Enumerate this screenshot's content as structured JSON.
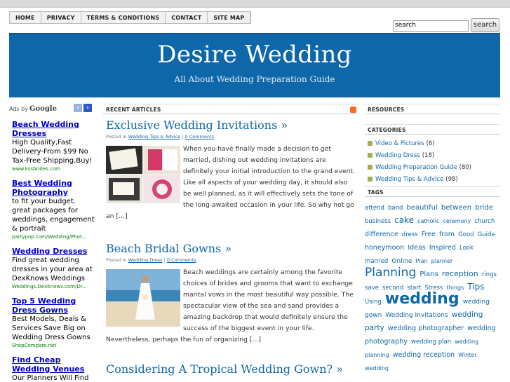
{
  "nav": [
    "HOME",
    "PRIVACY",
    "TERMS & CONDITIONS",
    "CONTACT",
    "SITE MAP"
  ],
  "search": {
    "value": "search",
    "button": "search"
  },
  "header": {
    "title": "Desire Wedding",
    "tagline": "All About Wedding Preparation Guide"
  },
  "ads": {
    "label_by": "Ads by",
    "label_google": "Google",
    "items": [
      {
        "title": "Beach Wedding Dresses",
        "body": "High Quality,Fast Delivery-From $99 No Tax-Free Shipping,Buy!",
        "url": "www.kssbrides.com"
      },
      {
        "title": "Best Wedding Photography",
        "body": "to fit your budget. great packages for weddings, engagement & portrait",
        "url": "partypop.com/Wedding/Phot..."
      },
      {
        "title": "Wedding Dresses",
        "body": "Find great wedding dresses in your area at DexKnows Weddings",
        "url": "Weddings.DexKnows.com/Dr..."
      },
      {
        "title": "Top 5 Wedding Dress Gowns",
        "body": "Best Models, Deals & Services Save Big on Wedding Dress Gowns",
        "url": "ShopCompare.net"
      },
      {
        "title": "Find Cheap Wedding Venues",
        "body": "Our Planners Will Find",
        "url": ""
      }
    ]
  },
  "main": {
    "section": "RECENT ARTICLES",
    "posts": [
      {
        "title": "Exclusive Wedding Invitations »",
        "posted_in": "Posted in",
        "category": "Wedding Tips & Advice",
        "sep": "|",
        "comments": "0 Comments",
        "excerpt": "When you have finally made a decision to get married, dishing out wedding invitations are definitely your initial introduction to the grand event. Like all aspects of your wedding day, it should also be well planned, as it will effectively sets the tone of the long-awaited occasion in your life. So why not go",
        "tail": "an […]"
      },
      {
        "title": "Beach Bridal Gowns »",
        "posted_in": "Posted in",
        "category": "Wedding Dress",
        "sep": "|",
        "comments": "0 Comments",
        "excerpt": "Beach weddings are certainly among the favorite choices of brides and grooms that want to exchange marital vows in the most beautiful way possible. The spectacular view of the sea and sand provides a amazing backdrop that would definitely ensure the success of the biggest event in your life.",
        "tail": "Nevertheless, perhaps the fun of organizing […]"
      },
      {
        "title": "Considering A Tropical Wedding Gown? »"
      }
    ]
  },
  "sidebar": {
    "resources": "RESOURCES",
    "categories_head": "CATEGORIES",
    "categories": [
      {
        "name": "Video & Pictures",
        "count": "(6)"
      },
      {
        "name": "Wedding Dress",
        "count": "(18)"
      },
      {
        "name": "Wedding Preparation Guide",
        "count": "(80)"
      },
      {
        "name": "Wedding Tips & Advice",
        "count": "(98)"
      }
    ],
    "tags_head": "TAGS",
    "tags": [
      {
        "t": "attend",
        "s": 8.5
      },
      {
        "t": "band",
        "s": 8.5
      },
      {
        "t": "beautiful",
        "s": 10
      },
      {
        "t": "between",
        "s": 10
      },
      {
        "t": "bride",
        "s": 10
      },
      {
        "t": "business",
        "s": 8.5
      },
      {
        "t": "cake",
        "s": 12
      },
      {
        "t": "catholic",
        "s": 8
      },
      {
        "t": "ceremony",
        "s": 8
      },
      {
        "t": "church",
        "s": 8.5
      },
      {
        "t": "difference",
        "s": 9.5
      },
      {
        "t": "dress",
        "s": 8.5
      },
      {
        "t": "Free",
        "s": 9.5
      },
      {
        "t": "from",
        "s": 9.5
      },
      {
        "t": "Good",
        "s": 8.5
      },
      {
        "t": "Guide",
        "s": 8.5
      },
      {
        "t": "honeymoon",
        "s": 9.5
      },
      {
        "t": "Ideas",
        "s": 9.5
      },
      {
        "t": "Inspired",
        "s": 9.5
      },
      {
        "t": "Look",
        "s": 8.5
      },
      {
        "t": "married",
        "s": 8.5
      },
      {
        "t": "Online",
        "s": 9
      },
      {
        "t": "Plan",
        "s": 8
      },
      {
        "t": "planner",
        "s": 8
      },
      {
        "t": "Planning",
        "s": 17
      },
      {
        "t": "Plans",
        "s": 10
      },
      {
        "t": "reception",
        "s": 11
      },
      {
        "t": "rings",
        "s": 8.5
      },
      {
        "t": "save",
        "s": 8.5
      },
      {
        "t": "second",
        "s": 8.5
      },
      {
        "t": "start",
        "s": 8.5
      },
      {
        "t": "Stress",
        "s": 8.5
      },
      {
        "t": "things",
        "s": 8
      },
      {
        "t": "Tips",
        "s": 12
      },
      {
        "t": "Using",
        "s": 8.5
      },
      {
        "t": "wedding",
        "s": 22
      },
      {
        "t": "wedding gown",
        "s": 9
      },
      {
        "t": "Wedding Invitations",
        "s": 9
      },
      {
        "t": "wedding party",
        "s": 10.5
      },
      {
        "t": "wedding photographer",
        "s": 9.5
      },
      {
        "t": "wedding photography",
        "s": 9.5
      },
      {
        "t": "wedding plan",
        "s": 8.5
      },
      {
        "t": "wedding planning",
        "s": 8
      },
      {
        "t": "wedding reception",
        "s": 9.5
      },
      {
        "t": "Winter",
        "s": 8
      },
      {
        "t": "wedding",
        "s": 8
      }
    ]
  }
}
